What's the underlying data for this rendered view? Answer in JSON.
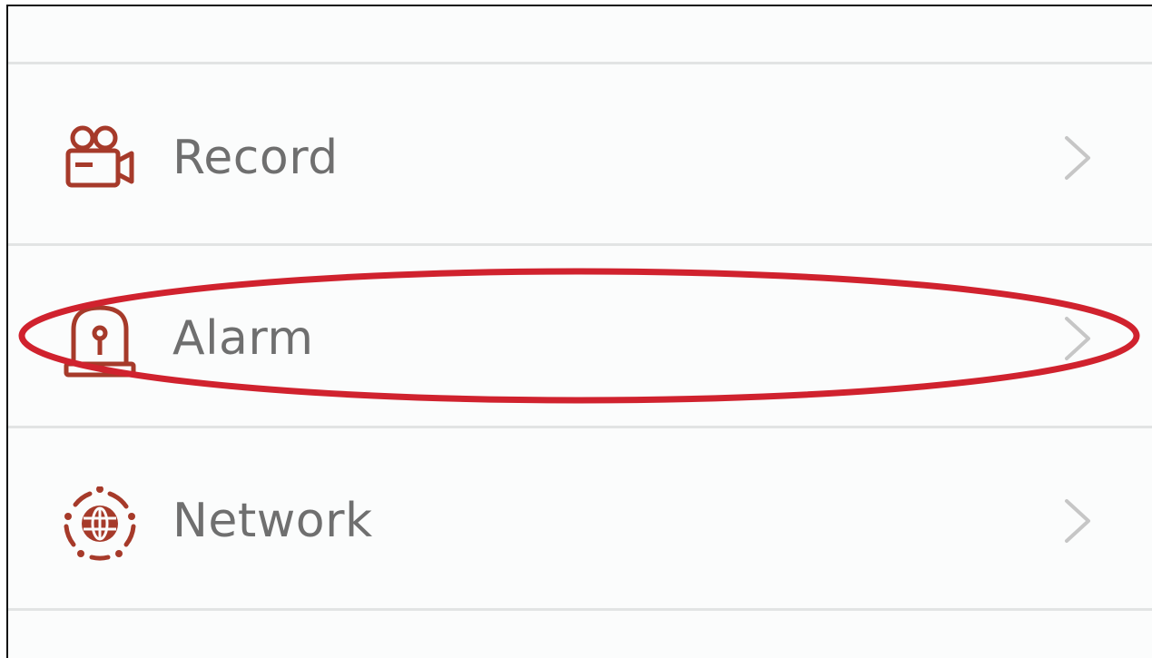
{
  "settings_menu": {
    "items": [
      {
        "label": "Record",
        "icon": "video-camera-icon"
      },
      {
        "label": "Alarm",
        "icon": "siren-icon"
      },
      {
        "label": "Network",
        "icon": "globe-network-icon"
      }
    ],
    "chevron_icon": "chevron-right-icon"
  },
  "colors": {
    "icon_accent": "#A63A2A",
    "label_text": "#6F6F6F",
    "chevron": "#C6C6C6",
    "highlight_ellipse": "#D0222E",
    "divider": "#E2E4E4"
  }
}
